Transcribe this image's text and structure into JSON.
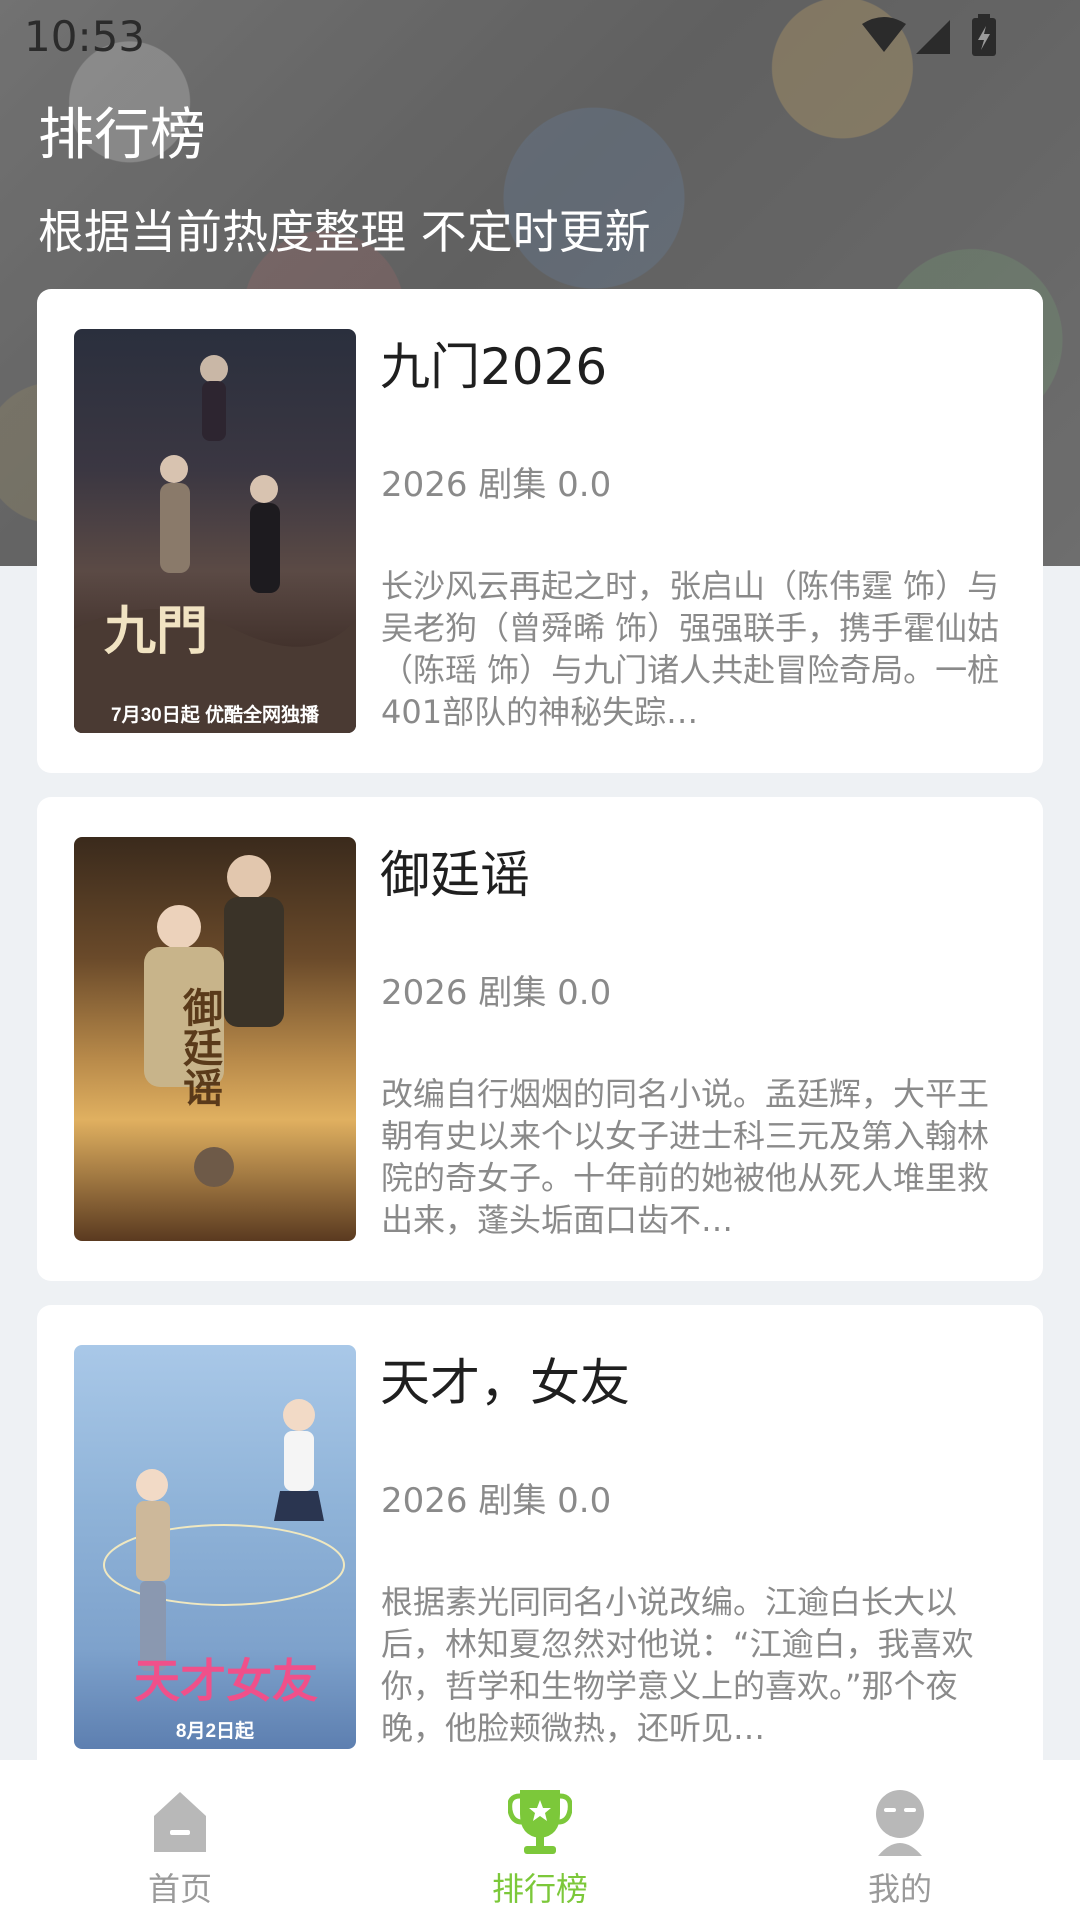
{
  "status_bar": {
    "time": "10:53"
  },
  "header": {
    "title": "排行榜",
    "subtitle": "根据当前热度整理 不定时更新"
  },
  "items": [
    {
      "title": "九门2026",
      "meta": "2026 剧集 0.0",
      "desc": "长沙风云再起之时，张启山（陈伟霆 饰）与吴老狗（曾舜晞 饰）强强联手，携手霍仙姑（陈瑶 饰）与九门诸人共赴冒险奇局。一桩401部队的神秘失踪…",
      "poster_caption": "7月30日起 优酷全网独播"
    },
    {
      "title": "御廷谣",
      "meta": "2026 剧集 0.0",
      "desc": "改编自行烟烟的同名小说。孟廷辉，大平王朝有史以来个以女子进士科三元及第入翰林院的奇女子。十年前的她被他从死人堆里救出来，蓬头垢面口齿不…",
      "poster_caption": ""
    },
    {
      "title": "天才，女友",
      "meta": "2026 剧集 0.0",
      "desc": "根据素光同同名小说改编。江逾白长大以后，林知夏忽然对他说：“江逾白，我喜欢你，哲学和生物学意义上的喜欢。”那个夜晚，他脸颊微热，还听见…",
      "poster_caption": "8月2日起"
    }
  ],
  "nav": [
    {
      "label": "首页",
      "icon": "home-icon",
      "active": false
    },
    {
      "label": "排行榜",
      "icon": "trophy-icon",
      "active": true
    },
    {
      "label": "我的",
      "icon": "profile-icon",
      "active": false
    }
  ],
  "colors": {
    "accent": "#7cc83a",
    "inactive": "#9a9a9a",
    "card_bg": "#ffffff",
    "page_bg": "#eef1f4"
  }
}
